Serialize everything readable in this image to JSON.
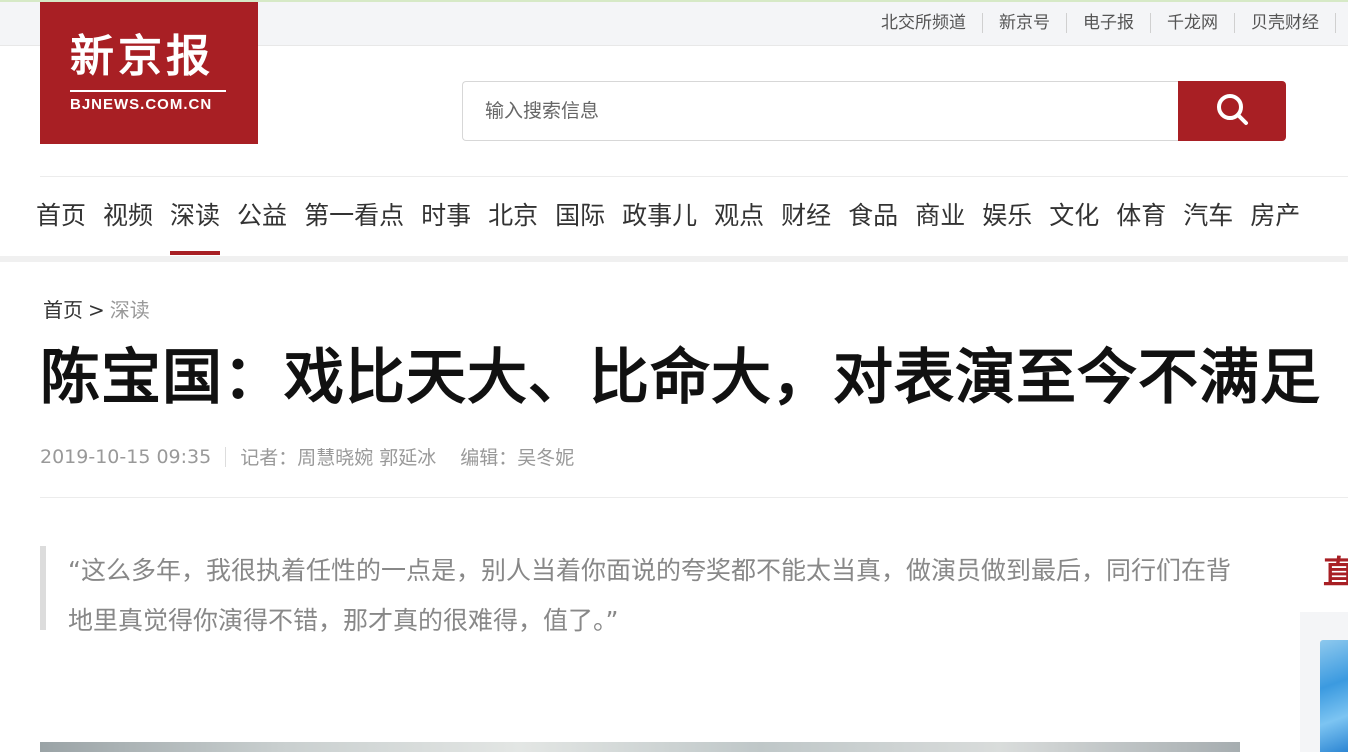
{
  "top_links": [
    "北交所频道",
    "新京号",
    "电子报",
    "千龙网",
    "贝壳财经"
  ],
  "logo": {
    "name_cn": "新京报",
    "name_en": "BJNEWS.COM.CN"
  },
  "search": {
    "placeholder": "输入搜索信息",
    "value": ""
  },
  "nav": {
    "items": [
      "首页",
      "视频",
      "深读",
      "公益",
      "第一看点",
      "时事",
      "北京",
      "国际",
      "政事儿",
      "观点",
      "财经",
      "食品",
      "商业",
      "娱乐",
      "文化",
      "体育",
      "汽车",
      "房产"
    ],
    "active": "深读"
  },
  "breadcrumb": {
    "home": "首页",
    "sep": ">",
    "current": "深读"
  },
  "article": {
    "title": "陈宝国：戏比天大、比命大，对表演至今不满足",
    "datetime": "2019-10-15 09:35",
    "reporter": "记者：周慧晓婉 郭延冰",
    "editor": "编辑：吴冬妮",
    "quote": "“这么多年，我很执着任性的一点是，别人当着你面说的夸奖都不能太当真，做演员做到最后，同行们在背地里真觉得你演得不错，那才真的很难得，值了。”"
  },
  "sidebar": {
    "heading_char": "直"
  },
  "colors": {
    "brand_red": "#a81f24",
    "meta_gray": "#999999",
    "quote_gray": "#888888"
  }
}
